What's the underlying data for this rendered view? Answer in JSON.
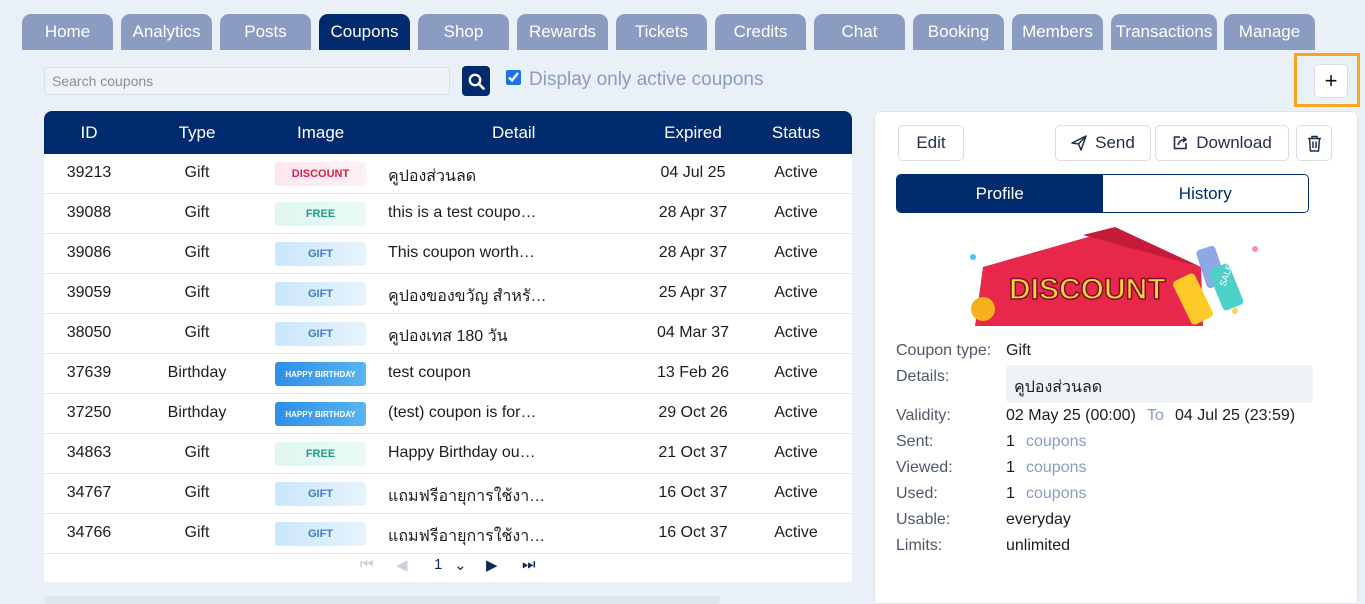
{
  "tabs": [
    "Home",
    "Analytics",
    "Posts",
    "Coupons",
    "Shop",
    "Rewards",
    "Tickets",
    "Credits",
    "Chat",
    "Booking",
    "Members",
    "Transactions",
    "Manage"
  ],
  "toolbar": {
    "search_placeholder": "Search coupons",
    "filter_label": "Display only active coupons",
    "add_label": "+"
  },
  "table": {
    "headers": {
      "id": "ID",
      "type": "Type",
      "image": "Image",
      "detail": "Detail",
      "expired": "Expired",
      "status": "Status"
    },
    "rows": [
      {
        "id": "39213",
        "type": "Gift",
        "image": "discount",
        "detail": "คูปองส่วนลด",
        "expired": "04 Jul 25",
        "status": "Active"
      },
      {
        "id": "39088",
        "type": "Gift",
        "image": "free",
        "detail": "this is a test coupo…",
        "expired": "28 Apr 37",
        "status": "Active"
      },
      {
        "id": "39086",
        "type": "Gift",
        "image": "gift",
        "detail": "This coupon worth…",
        "expired": "28 Apr 37",
        "status": "Active"
      },
      {
        "id": "39059",
        "type": "Gift",
        "image": "gift",
        "detail": "คูปองของขวัญ สำหรั…",
        "expired": "25 Apr 37",
        "status": "Active"
      },
      {
        "id": "38050",
        "type": "Gift",
        "image": "gift",
        "detail": "คูปองเทส 180 วัน",
        "expired": "04 Mar 37",
        "status": "Active"
      },
      {
        "id": "37639",
        "type": "Birthday",
        "image": "bday",
        "detail": "test coupon",
        "expired": "13 Feb 26",
        "status": "Active"
      },
      {
        "id": "37250",
        "type": "Birthday",
        "image": "bday",
        "detail": "(test) coupon is for…",
        "expired": "29 Oct 26",
        "status": "Active"
      },
      {
        "id": "34863",
        "type": "Gift",
        "image": "free",
        "detail": "Happy Birthday ou…",
        "expired": "21 Oct 37",
        "status": "Active"
      },
      {
        "id": "34767",
        "type": "Gift",
        "image": "gift",
        "detail": "แถมฟรีอายุการใช้งาน …",
        "expired": "16 Oct 37",
        "status": "Active"
      },
      {
        "id": "34766",
        "type": "Gift",
        "image": "gift",
        "detail": "แถมฟรีอายุการใช้งาน …",
        "expired": "16 Oct 37",
        "status": "Active"
      }
    ],
    "image_texts": {
      "discount": "DISCOUNT",
      "free": "FREE",
      "gift": "GIFT",
      "bday": "HAPPY BIRTHDAY"
    }
  },
  "pagination": {
    "current_page": "1"
  },
  "panel": {
    "edit_label": "Edit",
    "send_label": "Send",
    "download_label": "Download",
    "tab_profile": "Profile",
    "tab_history": "History",
    "banner_text": "DISCOUNT",
    "banner_tag": "SALE",
    "labels": {
      "coupon_type": "Coupon type:",
      "details": "Details:",
      "validity": "Validity:",
      "sent": "Sent:",
      "viewed": "Viewed:",
      "used": "Used:",
      "usable": "Usable:",
      "limits": "Limits:"
    },
    "values": {
      "coupon_type": "Gift",
      "details": "คูปองส่วนลด",
      "validity_from": "02 May 25 (00:00)",
      "validity_to_label": "To",
      "validity_to": "04 Jul 25 (23:59)",
      "sent": "1",
      "viewed": "1",
      "used": "1",
      "count_unit": "coupons",
      "usable": "everyday",
      "limits": "unlimited"
    }
  },
  "colors": {
    "primary": "#002a6e",
    "tab_inactive": "#8a9cc2",
    "highlight": "#f5a623",
    "background": "#eaf0f7"
  }
}
